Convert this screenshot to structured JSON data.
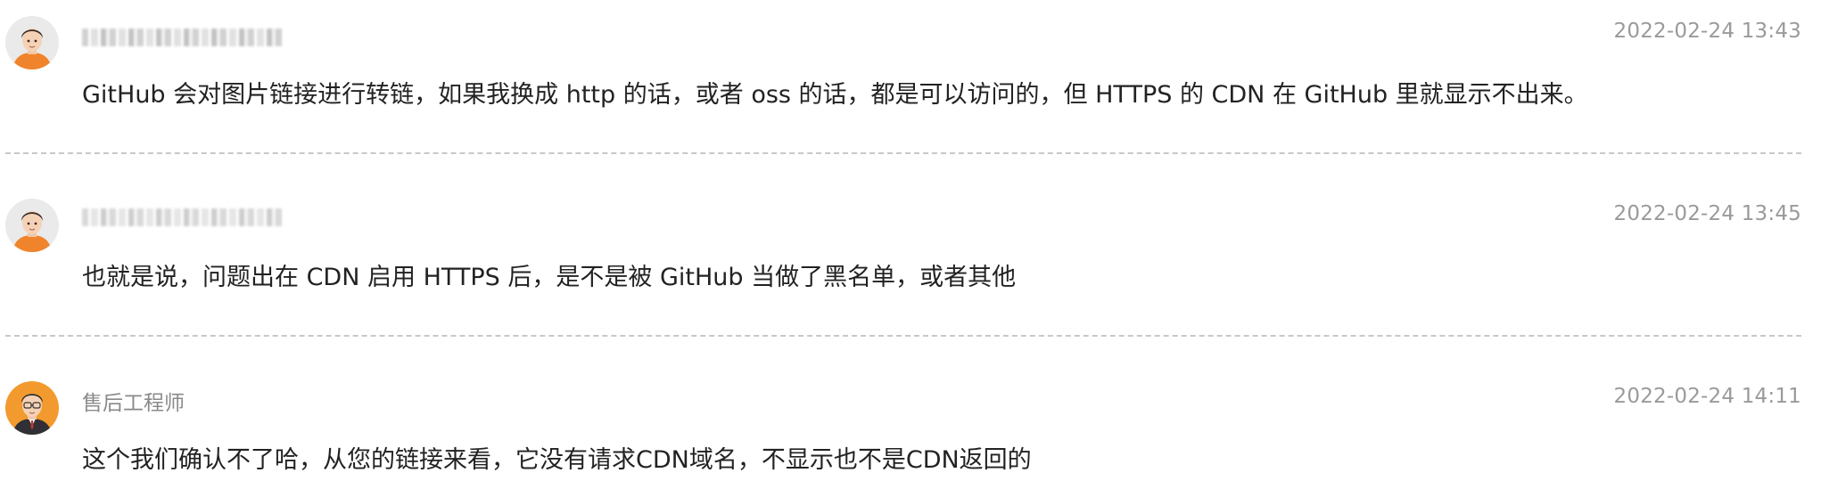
{
  "comments": [
    {
      "username": "",
      "username_obscured": true,
      "timestamp": "2022-02-24 13:43",
      "text": "GitHub 会对图片链接进行转链，如果我换成 http 的话，或者 oss 的话，都是可以访问的，但 HTTPS 的 CDN 在 GitHub 里就显示不出来。",
      "avatar": "user-avatar-icon"
    },
    {
      "username": "",
      "username_obscured": true,
      "timestamp": "2022-02-24 13:45",
      "text": "也就是说，问题出在 CDN 启用 HTTPS 后，是不是被 GitHub 当做了黑名单，或者其他",
      "avatar": "user-avatar-icon"
    },
    {
      "username": "售后工程师",
      "username_obscured": false,
      "timestamp": "2022-02-24 14:11",
      "text": "这个我们确认不了哈，从您的链接来看，它没有请求CDN域名，不显示也不是CDN返回的",
      "avatar": "engineer-avatar-icon"
    }
  ],
  "colors": {
    "avatar_bg_user": "#eaeaea",
    "avatar_shirt_user": "#f0842c",
    "avatar_bg_engineer": "#f39a2e",
    "divider": "#c8c8c8",
    "meta_text": "#9a9a9a",
    "body_text": "#222222"
  }
}
